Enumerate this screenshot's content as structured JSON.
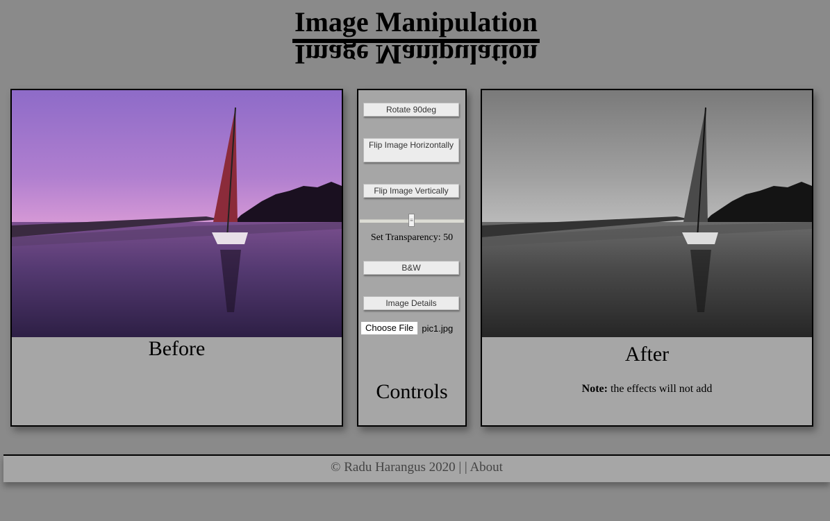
{
  "header": {
    "title": "Image Manipulation"
  },
  "before": {
    "caption": "Before"
  },
  "after": {
    "caption": "After",
    "note_label": "Note:",
    "note_text": " the effects will not add"
  },
  "controls": {
    "rotate_label": "Rotate 90deg",
    "flip_h_label": "Flip Image Horizontally",
    "flip_v_label": "Flip Image Vertically",
    "transparency_label": "Set Transparency: ",
    "transparency_value": "50",
    "bw_label": "B&W",
    "details_label": "Image Details",
    "file_button_label": "Choose File",
    "file_name": "pic1.jpg",
    "caption": "Controls"
  },
  "footer": {
    "copyright": "© Radu Harangus 2020 | | ",
    "about_label": "About"
  },
  "colors": {
    "background": "#8a8a8a",
    "panel": "#a6a6a6"
  }
}
